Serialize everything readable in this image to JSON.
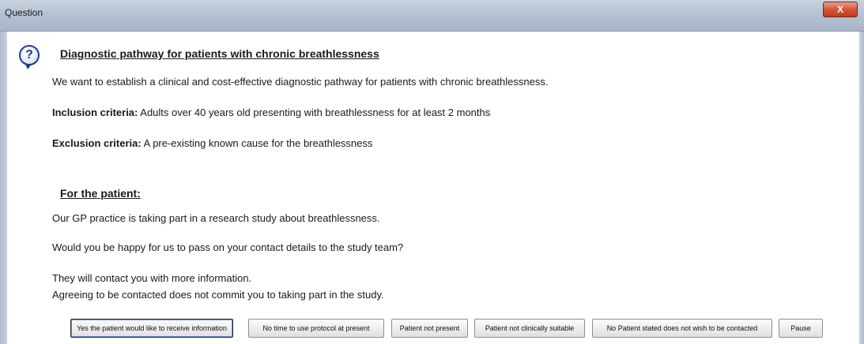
{
  "window": {
    "title": "Question",
    "close_label": "X"
  },
  "icon": {
    "glyph": "?"
  },
  "content": {
    "heading": "Diagnostic pathway for patients with chronic breathlessness",
    "intro": "We want to establish a clinical and cost-effective diagnostic pathway for patients with chronic breathlessness.",
    "inclusion_label": "Inclusion criteria:",
    "inclusion_text": "Adults over 40 years old presenting with breathlessness for at least 2 months",
    "exclusion_label": "Exclusion criteria:",
    "exclusion_text": "A pre-existing known cause for the breathlessness",
    "patient_heading": "For the patient:",
    "patient_line1": "Our GP practice is taking part in a research study about breathlessness.",
    "patient_line2": "Would you be happy for us to pass on your contact details to the study team?",
    "patient_line3": "They will contact you with more information.",
    "patient_line4": "Agreeing to be contacted does not commit you to taking part in the study."
  },
  "buttons": [
    {
      "label": "Yes the patient would like to receive information"
    },
    {
      "label": "No time to use protocol at present"
    },
    {
      "label": "Patient not present"
    },
    {
      "label": "Patient not clinically suitable"
    },
    {
      "label": "No   Patient stated does not wish to be contacted"
    },
    {
      "label": "Pause"
    }
  ]
}
